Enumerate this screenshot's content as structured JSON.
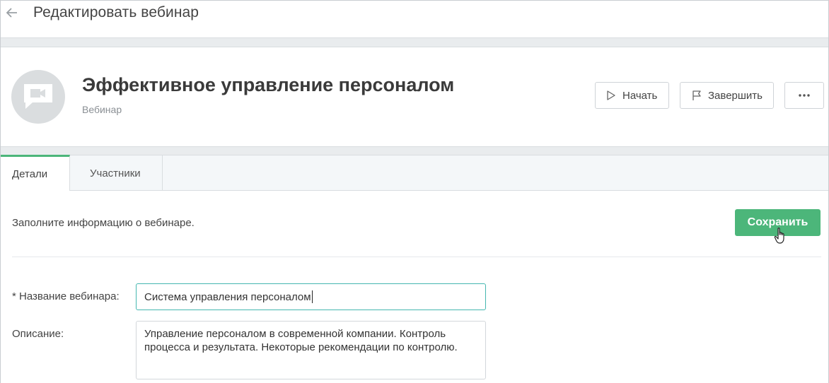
{
  "topbar": {
    "title": "Редактировать вебинар"
  },
  "header": {
    "webinar_title": "Эффективное управление персоналом",
    "webinar_type": "Вебинар",
    "start_label": "Начать",
    "finish_label": "Завершить"
  },
  "tabs": [
    {
      "label": "Детали",
      "active": true
    },
    {
      "label": "Участники",
      "active": false
    }
  ],
  "form": {
    "hint": "Заполните информацию о вебинаре.",
    "save_label": "Сохранить",
    "name_label": "* Название вебинара:",
    "name_value": "Система управления персоналом",
    "description_label": "Описание:",
    "description_value": "Управление персоналом в современной компании. Контроль процесса и результата. Некоторые рекомендации по контролю."
  },
  "colors": {
    "accent": "#4cb67a",
    "focus_border": "#45b7b0",
    "avatar_bg": "#dadddf"
  },
  "icons": {
    "back": "arrow-left-icon",
    "avatar": "video-chat-icon",
    "start": "play-icon",
    "finish": "flag-icon",
    "more": "more-horizontal-icon",
    "cursor": "hand-pointer-icon"
  }
}
